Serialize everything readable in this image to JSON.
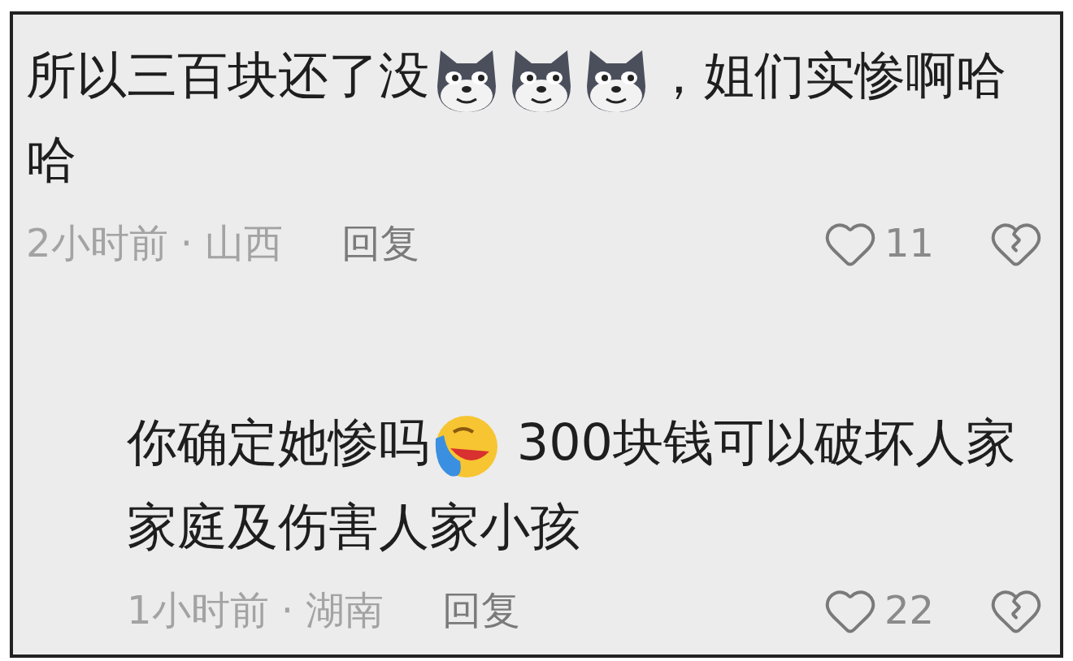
{
  "comments": [
    {
      "parts": [
        {
          "kind": "text",
          "text": "所以三百块还了没"
        },
        {
          "kind": "wolf"
        },
        {
          "kind": "wolf"
        },
        {
          "kind": "wolf"
        },
        {
          "kind": "text",
          "text": "，姐们实惨啊哈哈"
        }
      ],
      "meta": "2小时前 · 山西",
      "reply_label": "回复",
      "likes": "11",
      "replies": [
        {
          "parts": [
            {
              "kind": "text",
              "text": "你确定她惨吗"
            },
            {
              "kind": "laughing"
            },
            {
              "kind": "text",
              "text": " 300块钱可以破坏人家家庭及伤害人家小孩"
            }
          ],
          "meta": "1小时前 · 湖南",
          "reply_label": "回复",
          "likes": "22"
        }
      ]
    }
  ]
}
